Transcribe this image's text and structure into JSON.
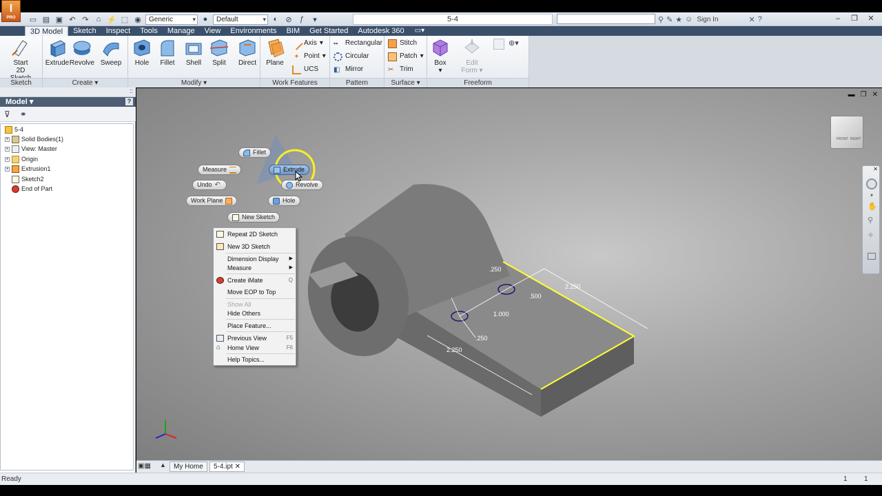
{
  "app": {
    "logo_letter": "I",
    "logo_sub": "PRO"
  },
  "titlebar": {
    "document_title": "5-4",
    "material_select": "Generic",
    "appearance_select": "Default",
    "sign_in": "Sign In"
  },
  "tabs": [
    {
      "label": "3D Model",
      "active": true
    },
    {
      "label": "Sketch"
    },
    {
      "label": "Inspect"
    },
    {
      "label": "Tools"
    },
    {
      "label": "Manage"
    },
    {
      "label": "View"
    },
    {
      "label": "Environments"
    },
    {
      "label": "BIM"
    },
    {
      "label": "Get Started"
    },
    {
      "label": "Autodesk 360"
    }
  ],
  "ribbon": {
    "sketch_panel": {
      "label": "Sketch",
      "start_sketch_line1": "Start",
      "start_sketch_line2": "2D Sketch"
    },
    "create_panel": {
      "label": "Create",
      "extrude": "Extrude",
      "revolve": "Revolve",
      "sweep": "Sweep"
    },
    "modify_panel": {
      "label": "Modify",
      "hole": "Hole",
      "fillet": "Fillet",
      "shell": "Shell",
      "split": "Split",
      "direct": "Direct"
    },
    "work_features_panel": {
      "label": "Work Features",
      "plane": "Plane",
      "axis": "Axis",
      "point": "Point",
      "ucs": "UCS"
    },
    "pattern_panel": {
      "label": "Pattern",
      "rectangular": "Rectangular",
      "circular": "Circular",
      "mirror": "Mirror"
    },
    "surface_panel": {
      "label": "Surface",
      "stitch": "Stitch",
      "patch": "Patch",
      "trim": "Trim"
    },
    "freeform_panel": {
      "label": "Freeform",
      "box": "Box",
      "edit_form_line1": "Edit",
      "edit_form_line2": "Form"
    }
  },
  "browser": {
    "title": "Model",
    "tree": [
      {
        "label": "5-4",
        "icon": "part-icon",
        "level": 0
      },
      {
        "label": "Solid Bodies(1)",
        "icon": "solid-bodies-icon",
        "level": 1
      },
      {
        "label": "View: Master",
        "icon": "view-icon",
        "level": 1
      },
      {
        "label": "Origin",
        "icon": "folder-icon",
        "level": 1
      },
      {
        "label": "Extrusion1",
        "icon": "extrusion-icon",
        "level": 1
      },
      {
        "label": "Sketch2",
        "icon": "sketch-icon",
        "level": 1
      },
      {
        "label": "End of Part",
        "icon": "end-of-part-icon",
        "level": 1
      }
    ]
  },
  "marking_menu": {
    "fillet": "Fillet",
    "measure": "Measure",
    "extrude": "Extrude",
    "undo": "Undo",
    "revolve": "Revolve",
    "work_plane": "Work Plane",
    "hole": "Hole",
    "new_sketch": "New Sketch"
  },
  "context_menu": [
    {
      "label": "Repeat 2D Sketch",
      "icon": "sketch-icon"
    },
    {
      "label": "New 3D Sketch",
      "icon": "sketch3d-icon"
    },
    {
      "label": "Dimension Display",
      "submenu": true
    },
    {
      "label": "Measure",
      "submenu": true
    },
    {
      "label": "Create iMate",
      "icon": "imate-icon",
      "shortcut": "Q"
    },
    {
      "label": "Move EOP to Top"
    },
    {
      "label": "Show All",
      "disabled": true
    },
    {
      "label": "Hide Others"
    },
    {
      "label": "Place Feature..."
    },
    {
      "label": "Previous View",
      "icon": "previous-view-icon",
      "shortcut": "F5"
    },
    {
      "label": "Home View",
      "icon": "home-icon",
      "shortcut": "F6"
    },
    {
      "label": "Help Topics..."
    }
  ],
  "dimensions": {
    "d1": "2.250",
    "d2": ".250",
    "d3": ".500",
    "d4": "1.000",
    "d5": ".250",
    "d6": "2.250"
  },
  "doc_tabs": {
    "home": "My Home",
    "file": "5-4.ipt"
  },
  "status": {
    "text": "Ready",
    "num1": "1",
    "num2": "1"
  },
  "colors": {
    "highlight_edge": "#ffff33",
    "hot_button": "#7fa3d2",
    "tab_bar": "#3a4f6a"
  }
}
